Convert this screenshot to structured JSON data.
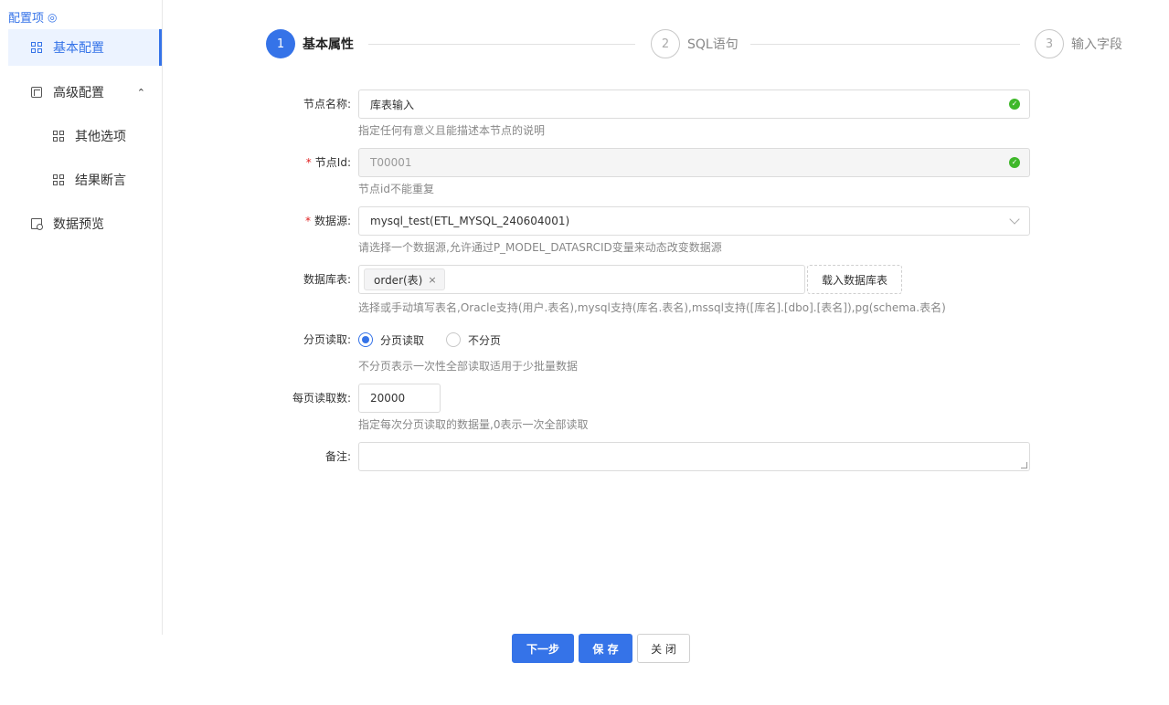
{
  "sidebar": {
    "header": "配置项",
    "items": [
      {
        "label": "基本配置"
      },
      {
        "label": "高级配置"
      },
      {
        "label": "其他选项"
      },
      {
        "label": "结果断言"
      },
      {
        "label": "数据预览"
      }
    ]
  },
  "steps": [
    {
      "num": "1",
      "label": "基本属性"
    },
    {
      "num": "2",
      "label": "SQL语句"
    },
    {
      "num": "3",
      "label": "输入字段"
    }
  ],
  "form": {
    "node_name": {
      "label": "节点名称:",
      "value": "库表输入",
      "hint": "指定任何有意义且能描述本节点的说明"
    },
    "node_id": {
      "required": "*",
      "label": "节点Id:",
      "value": "T00001",
      "hint": "节点id不能重复"
    },
    "datasource": {
      "required": "*",
      "label": "数据源:",
      "value": "mysql_test(ETL_MYSQL_240604001)",
      "hint": "请选择一个数据源,允许通过P_MODEL_DATASRCID变量来动态改变数据源"
    },
    "db_table": {
      "label": "数据库表:",
      "tag": "order(表)",
      "tag_close": "×",
      "load_button": "载入数据库表",
      "hint": "选择或手动填写表名,Oracle支持(用户.表名),mysql支持(库名.表名),mssql支持([库名].[dbo].[表名]),pg(schema.表名)"
    },
    "paging": {
      "label": "分页读取:",
      "options": [
        "分页读取",
        "不分页"
      ],
      "selected": "分页读取",
      "hint": "不分页表示一次性全部读取适用于少批量数据"
    },
    "page_size": {
      "label": "每页读取数:",
      "value": "20000",
      "hint": "指定每次分页读取的数据量,0表示一次全部读取"
    },
    "remark": {
      "label": "备注:",
      "value": ""
    }
  },
  "footer": {
    "next": "下一步",
    "save": "保 存",
    "close": "关 闭"
  },
  "colors": {
    "accent": "#3573e8",
    "success": "#3fb82a"
  }
}
